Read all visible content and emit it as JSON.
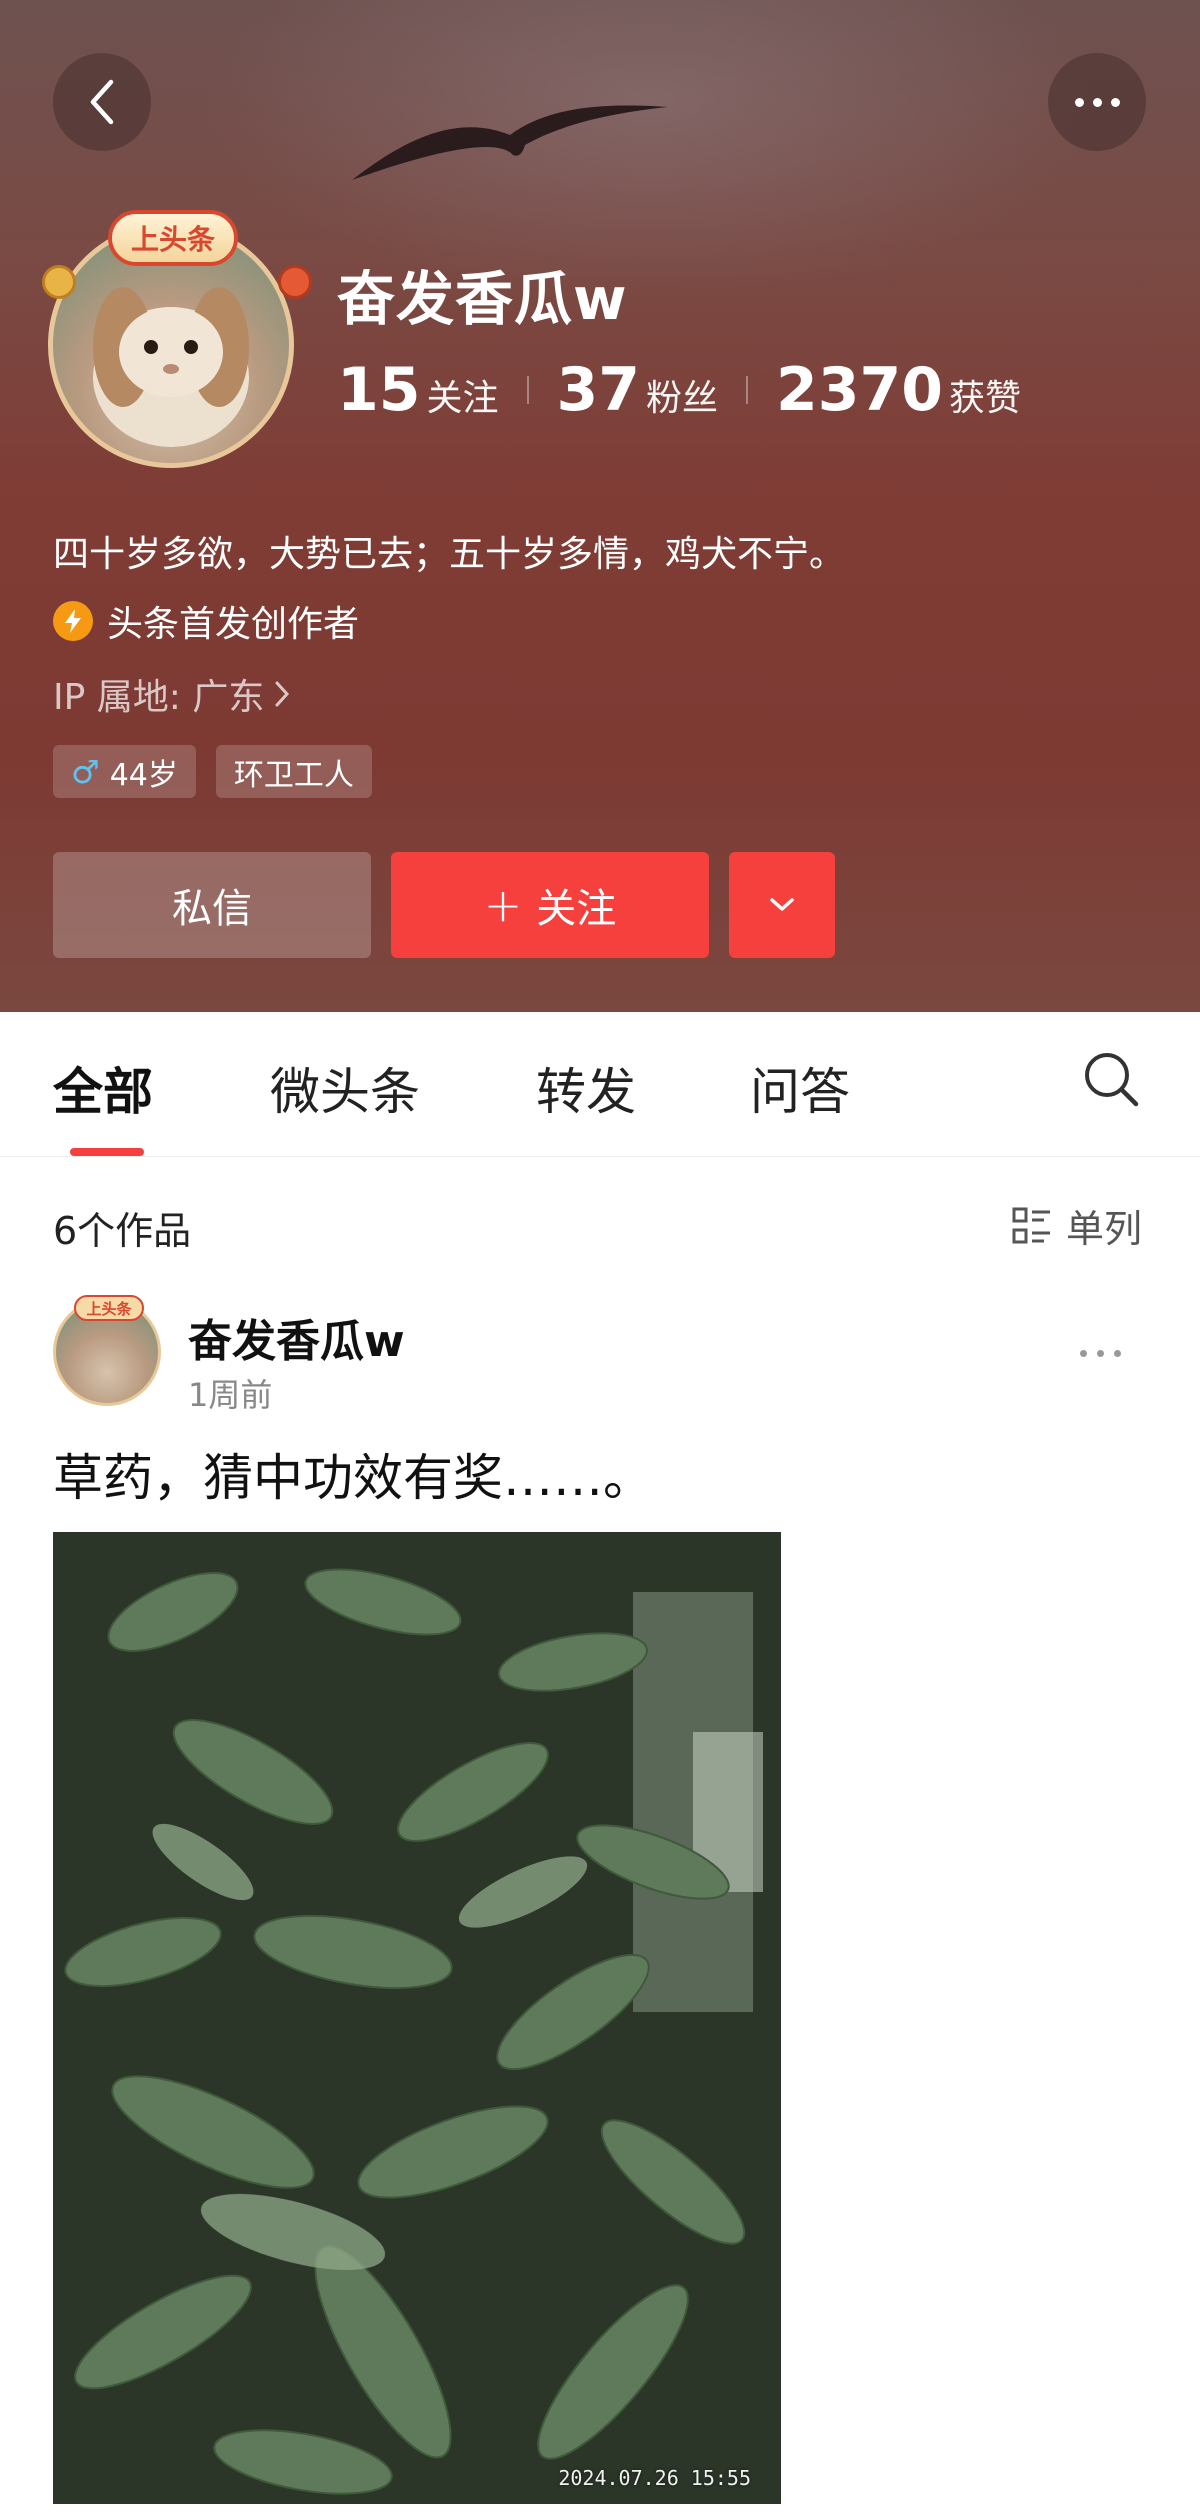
{
  "header": {
    "back_icon": "chevron-left-icon",
    "more_icon": "more-horizontal-icon",
    "avatar_badge": "上头条",
    "username": "奋发香瓜w",
    "stats": [
      {
        "num": "15",
        "label": "关注"
      },
      {
        "num": "37",
        "label": "粉丝"
      },
      {
        "num": "2370",
        "label": "获赞"
      }
    ],
    "bio": "四十岁多欲，大势已去；五十岁多情，鸡犬不宁。",
    "creator_label": "头条首发创作者",
    "ip_label": "IP 属地: 广东",
    "tags": [
      {
        "symbol": "♂",
        "label": "44岁"
      },
      {
        "symbol": "",
        "label": "环卫工人"
      }
    ],
    "message_button": "私信",
    "follow_button": "关注",
    "follow_plus": "+"
  },
  "tabs": [
    "全部",
    "微头条",
    "转发",
    "问答"
  ],
  "works_count": "6个作品",
  "layout_toggle": "单列",
  "post": {
    "author": "奋发香瓜w",
    "avatar_badge": "上头条",
    "time": "1周前",
    "text": "草药，猜中功效有奖……。",
    "image_timestamp": "2024.07.26  15:55"
  },
  "colors": {
    "accent": "#f5403d",
    "header_bg": "#7d3a33",
    "creator_badge": "#f59a12"
  }
}
